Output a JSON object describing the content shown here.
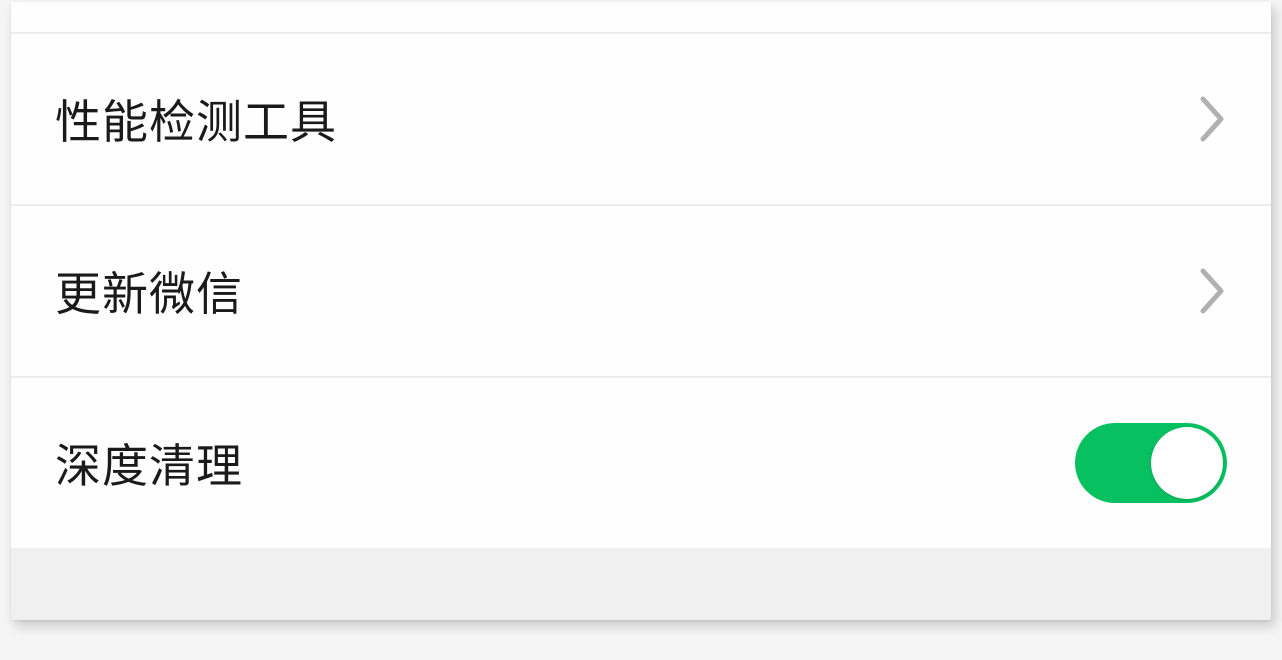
{
  "settings": {
    "items": [
      {
        "label": "性能检测工具",
        "type": "link"
      },
      {
        "label": "更新微信",
        "type": "link"
      },
      {
        "label": "深度清理",
        "type": "toggle",
        "value": true
      }
    ]
  },
  "colors": {
    "toggle_on": "#07c160"
  }
}
